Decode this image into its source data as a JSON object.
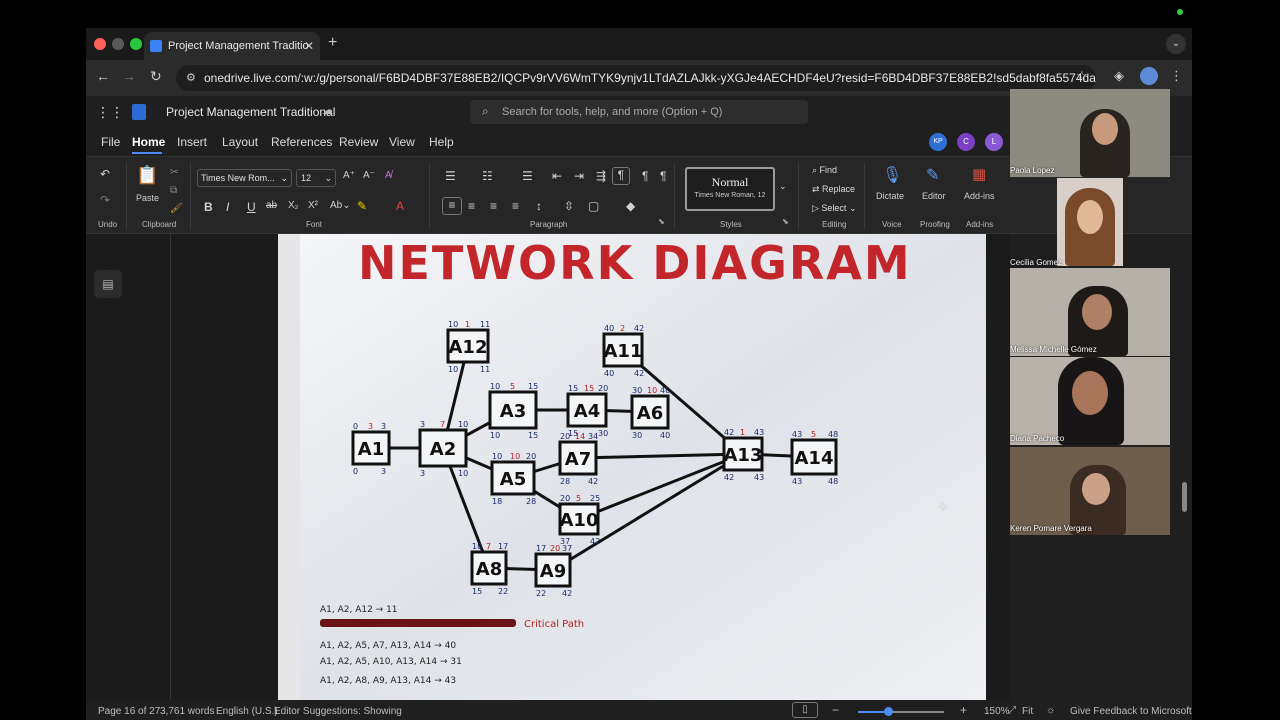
{
  "browser": {
    "tab_title": "Project Management Traditio",
    "url": "onedrive.live.com/:w:/g/personal/F6BD4DBF37E88EB2/IQCPv9rVV6WmTYK9ynjv1LTdAZLAJkk-yXGJe4AECHDF4eU?resid=F6BD4DBF37E88EB2!sd5dabf8fa5574da682bdc..."
  },
  "word": {
    "doc_title": "Project Management Traditional",
    "search_placeholder": "Search for tools, help, and more (Option + Q)",
    "menus": [
      "File",
      "Home",
      "Insert",
      "Layout",
      "References",
      "Review",
      "View",
      "Help"
    ],
    "active_menu": "Home",
    "avatars": [
      "KP",
      "C",
      "L"
    ],
    "font_name": "Times New Rom...",
    "font_size": "12",
    "style_name": "Normal",
    "style_sub": "Times New Roman, 12",
    "editing": [
      "Find",
      "Replace",
      "Select"
    ],
    "buttons": {
      "undo": "Undo",
      "paste": "Paste",
      "dictate": "Dictate",
      "editor": "Editor",
      "addins": "Add-ins"
    },
    "groups": {
      "undo": "Undo",
      "clipboard": "Clipboard",
      "font": "Font",
      "paragraph": "Paragraph",
      "styles": "Styles",
      "editing": "Editing",
      "voice": "Voice",
      "proofing": "Proofing",
      "addins": "Add-ins"
    },
    "status": {
      "page": "Page 16 of 27",
      "words": "3,761 words",
      "language": "English (U.S.)",
      "suggestions": "Editor Suggestions: Showing",
      "zoom": "150%",
      "fit": "Fit",
      "feedback": "Give Feedback to Microsoft"
    }
  },
  "diagram": {
    "title": "NETWORK DIAGRAM",
    "nodes": [
      {
        "id": "A1",
        "label": "A1",
        "es": "0",
        "d": "3",
        "ef": "3",
        "ls": "0",
        "lf": "3"
      },
      {
        "id": "A2",
        "label": "A2",
        "es": "3",
        "d": "7",
        "ef": "10",
        "ls": "3",
        "lf": "10"
      },
      {
        "id": "A12",
        "label": "A12",
        "es": "10",
        "d": "1",
        "ef": "11",
        "ls": "10",
        "lf": "11"
      },
      {
        "id": "A3",
        "label": "A3",
        "es": "10",
        "d": "5",
        "ef": "15",
        "ls": "10",
        "lf": "15"
      },
      {
        "id": "A4",
        "label": "A4",
        "es": "15",
        "d": "15",
        "ef": "20",
        "ls": "15",
        "lf": "30"
      },
      {
        "id": "A6",
        "label": "A6",
        "es": "30",
        "d": "10",
        "ef": "40",
        "ls": "30",
        "lf": "40"
      },
      {
        "id": "A11",
        "label": "A11",
        "es": "40",
        "d": "2",
        "ef": "42",
        "ls": "40",
        "lf": "42"
      },
      {
        "id": "A5",
        "label": "A5",
        "es": "10",
        "d": "10",
        "ef": "20",
        "ls": "18",
        "lf": "28"
      },
      {
        "id": "A7",
        "label": "A7",
        "es": "20",
        "d": "14",
        "ef": "34",
        "ls": "28",
        "lf": "42"
      },
      {
        "id": "A10",
        "label": "A10",
        "es": "20",
        "d": "5",
        "ef": "25",
        "ls": "37",
        "lf": "42"
      },
      {
        "id": "A13",
        "label": "A13",
        "es": "42",
        "d": "1",
        "ef": "43",
        "ls": "42",
        "lf": "43"
      },
      {
        "id": "A14",
        "label": "A14",
        "es": "43",
        "d": "5",
        "ef": "48",
        "ls": "43",
        "lf": "48"
      },
      {
        "id": "A8",
        "label": "A8",
        "es": "10",
        "d": "7",
        "ef": "17",
        "ls": "15",
        "lf": "22"
      },
      {
        "id": "A9",
        "label": "A9",
        "es": "17",
        "d": "20",
        "ef": "37",
        "ls": "22",
        "lf": "42"
      }
    ],
    "paths": [
      {
        "text": "A1, A2, A12 → 11"
      },
      {
        "text": "A1, A2, A5, A7, A13, A14 → 40"
      },
      {
        "text": "A1, A2, A5, A10, A13, A14 → 31"
      },
      {
        "text": "A1, A2, A8, A9, A13, A14 → 43"
      }
    ],
    "critical_label": "Critical Path"
  },
  "participants": [
    "Paola Lopez",
    "Cecilia Gomez",
    "Melissa Michelle Gómez",
    "Diana Pacheco",
    "Keren Pomare Vergara"
  ]
}
